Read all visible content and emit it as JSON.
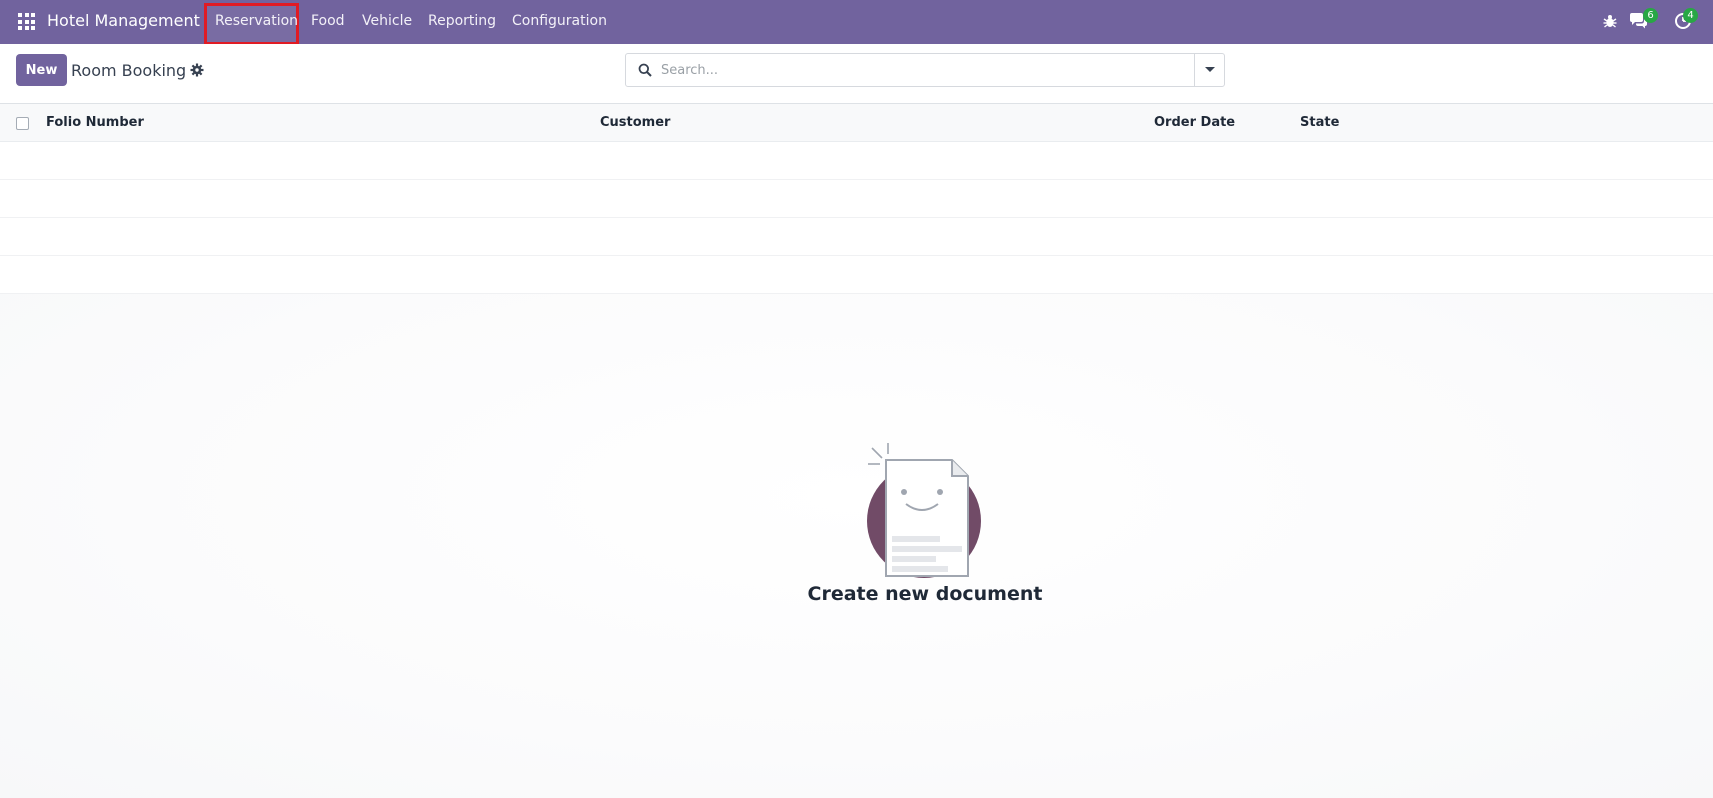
{
  "navbar": {
    "brand": "Hotel Management",
    "menu": [
      {
        "label": "Reservation"
      },
      {
        "label": "Food"
      },
      {
        "label": "Vehicle"
      },
      {
        "label": "Reporting"
      },
      {
        "label": "Configuration"
      }
    ],
    "systray": {
      "messages_count": "6",
      "activities_count": "4"
    },
    "colors": {
      "bar": "#71639e",
      "badge": "#28a745",
      "highlight": "#e01b24"
    }
  },
  "control_panel": {
    "new_label": "New",
    "title": "Room Booking",
    "search_placeholder": "Search..."
  },
  "list": {
    "columns": [
      "Folio Number",
      "Customer",
      "Order Date",
      "State"
    ]
  },
  "empty_state": {
    "title": "Create new document"
  }
}
